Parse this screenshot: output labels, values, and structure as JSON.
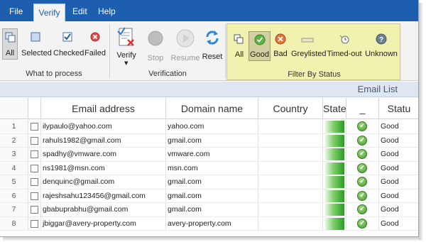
{
  "menu": {
    "items": [
      {
        "label": "File"
      },
      {
        "label": "Verify",
        "active": true
      },
      {
        "label": "Edit"
      },
      {
        "label": "Help"
      }
    ]
  },
  "ribbon": {
    "what_to_process": {
      "label": "What to process",
      "buttons": [
        {
          "label": "All",
          "icon": "all-items-icon",
          "selected": true
        },
        {
          "label": "Selected",
          "icon": "selected-items-icon"
        },
        {
          "label": "Checked",
          "icon": "checked-items-icon"
        },
        {
          "label": "Failed",
          "icon": "failed-items-icon"
        }
      ]
    },
    "verification": {
      "label": "Verification",
      "buttons": [
        {
          "label": "Verify",
          "icon": "verify-icon",
          "dropdown": true
        },
        {
          "label": "Stop",
          "icon": "stop-icon",
          "disabled": true
        },
        {
          "label": "Resume",
          "icon": "resume-icon",
          "disabled": true
        },
        {
          "label": "Reset",
          "icon": "reset-icon"
        }
      ]
    },
    "filter_by_status": {
      "label": "Filter By Status",
      "buttons": [
        {
          "label": "All",
          "icon": "all-status-icon"
        },
        {
          "label": "Good",
          "icon": "good-status-icon",
          "selected": true
        },
        {
          "label": "Bad",
          "icon": "bad-status-icon"
        },
        {
          "label": "Greylisted",
          "icon": "greylisted-icon"
        },
        {
          "label": "Timed-out",
          "icon": "timed-out-icon"
        },
        {
          "label": "Unknown",
          "icon": "unknown-icon"
        }
      ]
    }
  },
  "grid": {
    "title": "Email List",
    "columns": [
      "",
      "",
      "Email address",
      "Domain name",
      "Country",
      "State",
      "_",
      "Statu"
    ],
    "rows": [
      {
        "num": "1",
        "email": "ilypaulo@yahoo.com",
        "domain": "yahoo.com",
        "country": "",
        "status": "Good"
      },
      {
        "num": "2",
        "email": "rahuls1982@gmail.com",
        "domain": "gmail.com",
        "country": "",
        "status": "Good"
      },
      {
        "num": "3",
        "email": "spadhy@vmware.com",
        "domain": "vmware.com",
        "country": "",
        "status": "Good"
      },
      {
        "num": "4",
        "email": "ns1981@msn.com",
        "domain": "msn.com",
        "country": "",
        "status": "Good"
      },
      {
        "num": "5",
        "email": "denquinc@gmail.com",
        "domain": "gmail.com",
        "country": "",
        "status": "Good"
      },
      {
        "num": "6",
        "email": "rajeshsahu123456@gmail.com",
        "domain": "gmail.com",
        "country": "",
        "status": "Good"
      },
      {
        "num": "7",
        "email": "gbabuprabhu@gmail.com",
        "domain": "gmail.com",
        "country": "",
        "status": "Good"
      },
      {
        "num": "8",
        "email": "jbiggar@avery-property.com",
        "domain": "avery-property.com",
        "country": "",
        "status": "Good"
      }
    ]
  },
  "colors": {
    "menubar": "#1d5fae",
    "filter_group": "#f2f2b0",
    "good": "#3f9a2a"
  }
}
